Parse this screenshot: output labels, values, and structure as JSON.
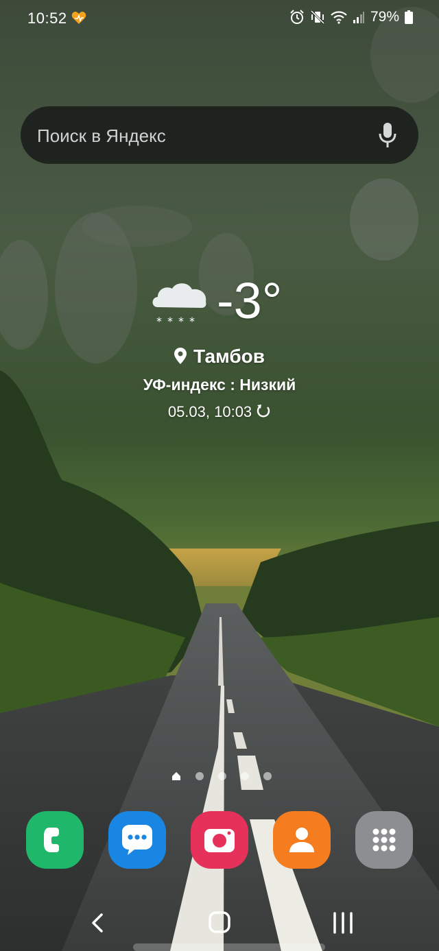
{
  "status_bar": {
    "time": "10:52",
    "battery": "79%",
    "icons": [
      "heart-sync-icon",
      "alarm-icon",
      "vibrate-mute-icon",
      "wifi-icon",
      "signal-icon",
      "battery-icon"
    ]
  },
  "search": {
    "placeholder": "Поиск в Яндекс",
    "icon": "mic-icon"
  },
  "weather": {
    "temperature": "-3°",
    "condition_icon": "snow-cloud-icon",
    "location": "Тамбов",
    "uv_index": "УФ-индекс : Низкий",
    "updated": "05.03, 10:03"
  },
  "pages": {
    "count": 5,
    "current": 0
  },
  "dock": {
    "apps": [
      {
        "name": "phone-icon",
        "color": "#1fb86a"
      },
      {
        "name": "messages-icon",
        "color": "#1a86e3"
      },
      {
        "name": "camera-icon",
        "color": "#e6315a"
      },
      {
        "name": "contacts-icon",
        "color": "#f57c1f"
      },
      {
        "name": "apps-icon",
        "color": "#8c8e91"
      }
    ]
  },
  "nav": {
    "back": "back-icon",
    "home": "home-icon",
    "recents": "recents-icon"
  }
}
